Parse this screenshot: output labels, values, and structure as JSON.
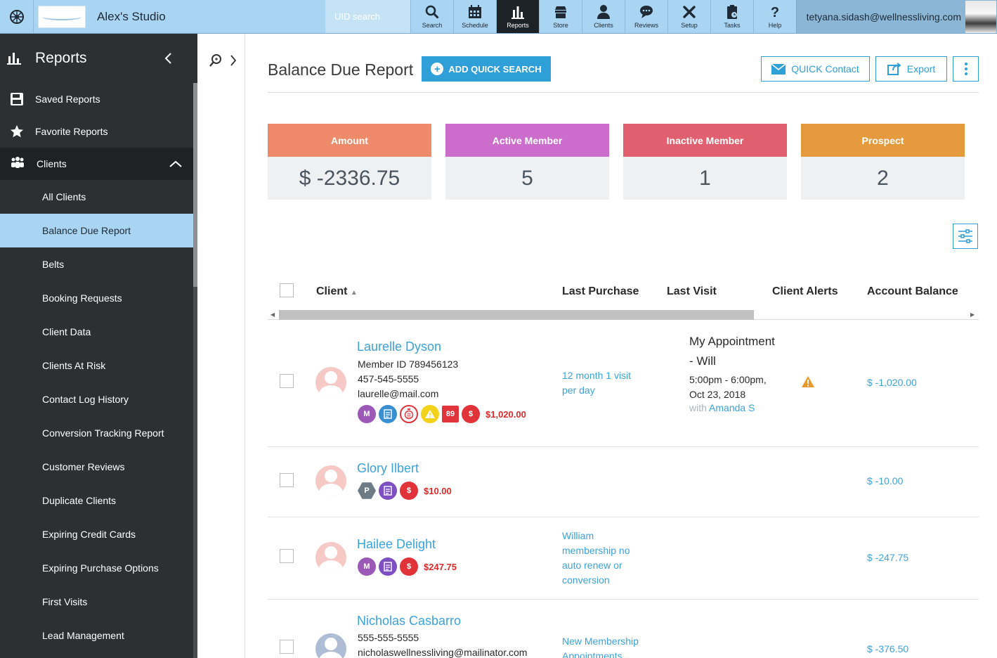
{
  "header": {
    "studio_name": "Alex's Studio",
    "uid_placeholder": "UID search",
    "nav": [
      {
        "label": "Search",
        "icon": "search-icon"
      },
      {
        "label": "Schedule",
        "icon": "calendar-icon"
      },
      {
        "label": "Reports",
        "icon": "bar-chart-icon",
        "active": true
      },
      {
        "label": "Store",
        "icon": "store-icon"
      },
      {
        "label": "Clients",
        "icon": "person-icon"
      },
      {
        "label": "Reviews",
        "icon": "chat-bubble-icon"
      },
      {
        "label": "Setup",
        "icon": "tools-icon"
      },
      {
        "label": "Tasks",
        "icon": "clipboard-icon"
      },
      {
        "label": "Help",
        "icon": "question-icon"
      }
    ],
    "user_email": "tetyana.sidash@wellnessliving.com"
  },
  "sidebar": {
    "title": "Reports",
    "top_items": [
      {
        "label": "Saved Reports",
        "icon": "floppy-disk-icon"
      },
      {
        "label": "Favorite Reports",
        "icon": "star-icon"
      }
    ],
    "group": {
      "label": "Clients",
      "icon": "people-icon"
    },
    "sub_items": [
      {
        "label": "All Clients"
      },
      {
        "label": "Balance Due Report",
        "active": true
      },
      {
        "label": "Belts"
      },
      {
        "label": "Booking Requests"
      },
      {
        "label": "Client Data"
      },
      {
        "label": "Clients At Risk"
      },
      {
        "label": "Contact Log History"
      },
      {
        "label": "Conversion Tracking Report"
      },
      {
        "label": "Customer Reviews"
      },
      {
        "label": "Duplicate Clients"
      },
      {
        "label": "Expiring Credit Cards"
      },
      {
        "label": "Expiring Purchase Options"
      },
      {
        "label": "First Visits"
      },
      {
        "label": "Lead Management"
      }
    ]
  },
  "page": {
    "title": "Balance Due Report",
    "add_quick_search": "ADD QUICK SEARCH",
    "quick_contact": "QUICK Contact",
    "export": "Export"
  },
  "stats": [
    {
      "label": "Amount",
      "value": "$ -2336.75",
      "color": "#ec8a6a"
    },
    {
      "label": "Active Member",
      "value": "5",
      "color": "#cc6ccb"
    },
    {
      "label": "Inactive Member",
      "value": "1",
      "color": "#e1606f"
    },
    {
      "label": "Prospect",
      "value": "2",
      "color": "#e59a3e"
    }
  ],
  "table": {
    "columns": [
      "Client",
      "Last Purchase",
      "Last Visit",
      "Client Alerts",
      "Account Balance"
    ],
    "rows": [
      {
        "name": "Laurelle Dyson",
        "member_id": "Member ID 789456123",
        "phone": "457-545-5555",
        "email": "laurelle@mail.com",
        "badge_m": "M",
        "badge_num": "89",
        "badge_amount": "$1,020.00",
        "last_purchase": "12 month 1 visit per day",
        "last_visit_title": "My Appointment - Will",
        "last_visit_time": "5:00pm - 6:00pm, Oct 23, 2018",
        "last_visit_with": "with",
        "last_visit_staff": "Amanda S",
        "alert_icon": "warning-triangle-icon",
        "balance": "$ -1,020.00"
      },
      {
        "name": "Glory Ilbert",
        "badge_p": "P",
        "badge_amount": "$10.00",
        "balance": "$ -10.00"
      },
      {
        "name": "Hailee Delight",
        "badge_m": "M",
        "badge_amount": "$247.75",
        "last_purchase": "William membership no auto renew or conversion",
        "balance": "$ -247.75"
      },
      {
        "name": "Nicholas Casbarro",
        "phone": "555-555-5555",
        "email": "nicholaswellnessliving@mailinator.com",
        "last_purchase": "New Membership Appointments",
        "balance": "$ -376.50"
      }
    ]
  }
}
